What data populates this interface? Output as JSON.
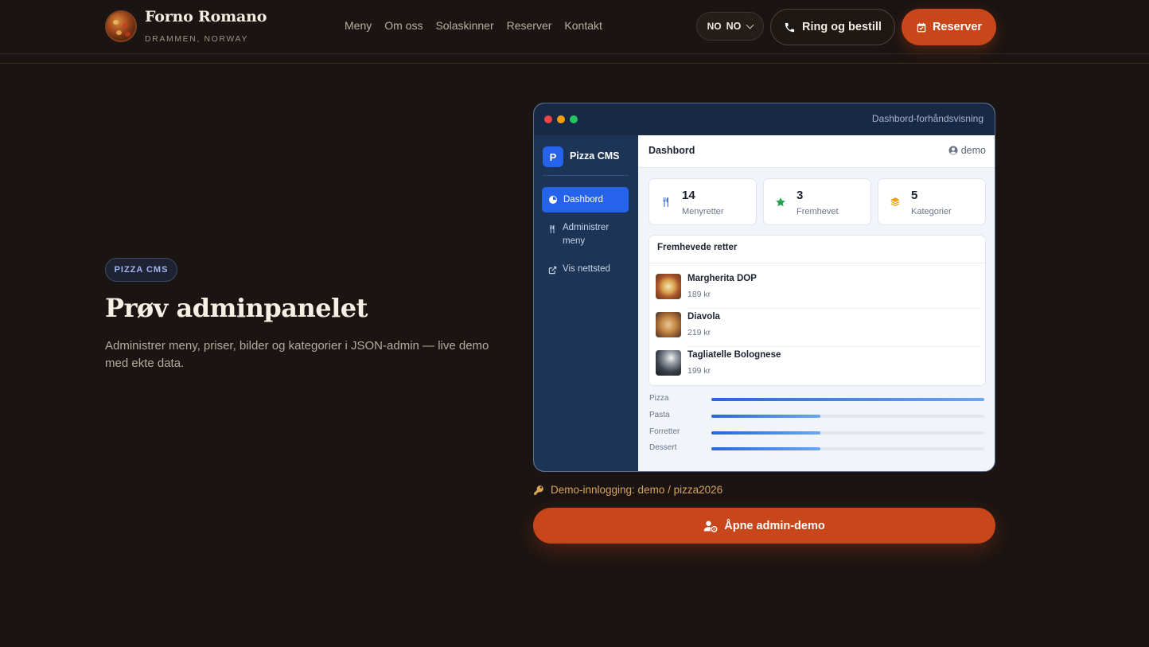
{
  "brand": {
    "name": "Forno Romano",
    "location": "DRAMMEN, NORWAY"
  },
  "nav": [
    {
      "label": "Meny"
    },
    {
      "label": "Om oss"
    },
    {
      "label": "Solaskinner"
    },
    {
      "label": "Reserver"
    },
    {
      "label": "Kontakt"
    }
  ],
  "header_actions": {
    "language_flag": "NO",
    "language_value": "NO",
    "call_label": "Ring og bestill",
    "reserve_label": "Reserver"
  },
  "hero": {
    "badge": "PIZZA CMS",
    "title": "Prøv adminpanelet",
    "description": "Administrer meny, priser, bilder og kategorier i JSON-admin — live demo med ekte data."
  },
  "preview": {
    "window_title": "Dashbord-forhåndsvisning",
    "app_name": "Pizza CMS",
    "app_logo_letter": "P",
    "sidebar": [
      {
        "label": "Dashbord",
        "icon": "dashboard-icon",
        "active": true
      },
      {
        "label": "Administrer meny",
        "icon": "utensils-icon",
        "active": false
      },
      {
        "label": "Vis nettsted",
        "icon": "external-link-icon",
        "active": false
      }
    ],
    "page_title": "Dashbord",
    "user": "demo",
    "stats": [
      {
        "value": "14",
        "label": "Menyretter",
        "icon": "utensils-icon",
        "color": "#3b6fd6"
      },
      {
        "value": "3",
        "label": "Fremhevet",
        "icon": "star-icon",
        "color": "#22a34a"
      },
      {
        "value": "5",
        "label": "Kategorier",
        "icon": "layers-icon",
        "color": "#e8a317"
      }
    ],
    "featured": {
      "title": "Fremhevede retter",
      "items": [
        {
          "name": "Margherita DOP",
          "price": "189 kr"
        },
        {
          "name": "Diavola",
          "price": "219 kr"
        },
        {
          "name": "Tagliatelle Bolognese",
          "price": "199 kr"
        }
      ]
    },
    "categories": [
      {
        "label": "Pizza",
        "level": 1.0
      },
      {
        "label": "Pasta",
        "level": 0.4
      },
      {
        "label": "Forretter",
        "level": 0.4
      },
      {
        "label": "Dessert",
        "level": 0.4
      }
    ]
  },
  "demo_login": "Demo-innlogging: demo / pizza2026",
  "open_demo_label": "Åpne admin-demo",
  "colors": {
    "accent": "#c9461a",
    "panel_sidebar": "#1c3557",
    "active_blue": "#2563eb"
  }
}
